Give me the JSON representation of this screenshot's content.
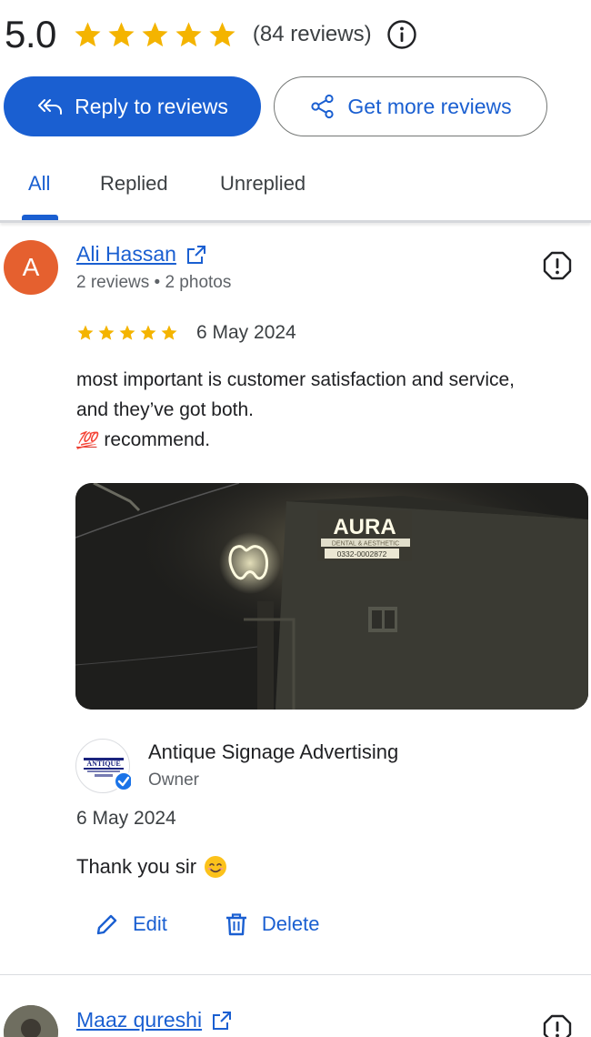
{
  "summary": {
    "rating": "5.0",
    "star_count": 5,
    "review_count_label": "(84 reviews)"
  },
  "actions": {
    "reply_label": "Reply to reviews",
    "get_more_label": "Get more reviews"
  },
  "tabs": [
    {
      "label": "All",
      "active": true
    },
    {
      "label": "Replied",
      "active": false
    },
    {
      "label": "Unreplied",
      "active": false
    }
  ],
  "reviews": [
    {
      "avatar_initial": "A",
      "avatar_color": "#e5602f",
      "name": "Ali Hassan",
      "meta": "2 reviews • 2 photos",
      "stars": 5,
      "date": "6 May 2024",
      "text_lines": [
        "most important is customer satisfaction and service,",
        "and they’ve got both."
      ],
      "text_emoji": "💯",
      "text_last": "recommend.",
      "photo": {
        "sign_title": "AURA",
        "sign_subtitle": "DENTAL & AESTHETIC",
        "sign_phone": "0332-0002872"
      },
      "owner_reply": {
        "owner_name": "Antique Signage Advertising",
        "owner_role": "Owner",
        "logo_text": "ANTIQUE",
        "date": "6 May 2024",
        "text": "Thank you sir",
        "edit_label": "Edit",
        "delete_label": "Delete"
      }
    },
    {
      "name": "Maaz qureshi"
    }
  ],
  "colors": {
    "accent": "#1a5fd1",
    "star": "#f4b400",
    "text": "#202124",
    "muted": "#5f6368"
  }
}
